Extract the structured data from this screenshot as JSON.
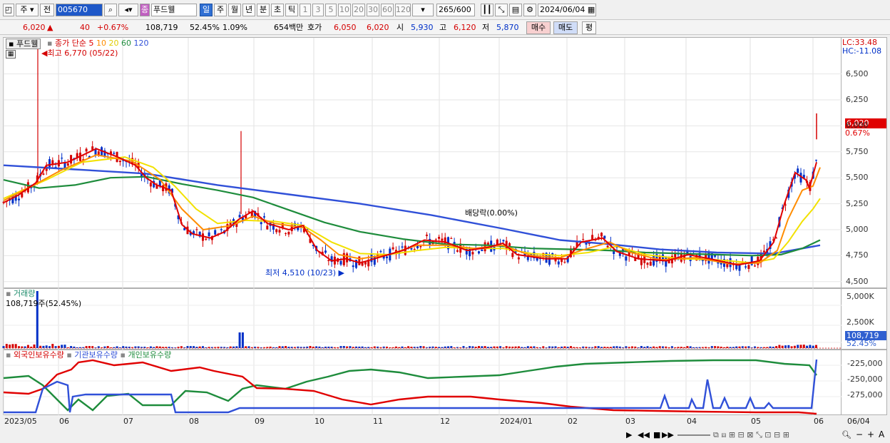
{
  "toolbar": {
    "period_type": "주",
    "all_label": "전",
    "code": "005670",
    "name_badge": "종",
    "stock_name": "푸드웰",
    "periods": [
      "일",
      "주",
      "월",
      "년",
      "분",
      "초",
      "틱"
    ],
    "minute_values": [
      "1",
      "3",
      "5",
      "10",
      "20",
      "30",
      "60",
      "120"
    ],
    "count": "265",
    "count_total": "/600",
    "date": "2024/06/04"
  },
  "quote": {
    "price": "6,020",
    "change_arrow": "▲",
    "change": "40",
    "change_pct": "+0.67%",
    "volume": "108,719",
    "volume_ratio": "52.45%",
    "turnover": "1.09%",
    "amount": "654백만",
    "ask_label": "호가",
    "ask": "6,050",
    "bid": "6,020",
    "open_label": "시",
    "open": "5,930",
    "high_label": "고",
    "high": "6,120",
    "low_label": "저",
    "low": "5,870",
    "buy_button": "매수",
    "sell_button": "매도",
    "flat_button": "평"
  },
  "price_panel": {
    "stock_tag": "푸드웰",
    "legend_prefix": "종가 단순",
    "ma_periods": [
      "5",
      "10",
      "20",
      "60",
      "120"
    ],
    "high_note": "최고 6,770 (05/22)",
    "low_note": "최저 4,510 (10/23)",
    "dividend_note": "배당락(0.00%)",
    "lc": "LC:33.48",
    "hc": "HC:-11.08",
    "current_price_tag": "6,020",
    "current_pct_tag": "0.67%"
  },
  "volume_panel": {
    "title": "거래량",
    "value_note": "108,719주(52.45%)",
    "current_tag": "108,719",
    "pct_tag": "52.45%"
  },
  "holdings_panel": {
    "foreign": "외국인보유수량",
    "institution": "기관보유수량",
    "individual": "개인보유수량"
  },
  "axes": {
    "price_ticks": [
      "6,500",
      "6,250",
      "6,000",
      "5,750",
      "5,500",
      "5,250",
      "5,000",
      "4,750",
      "4,500"
    ],
    "volume_ticks": [
      "5,000K",
      "2,500K"
    ],
    "holdings_ticks": [
      "-225,000",
      "-250,000",
      "-275,000"
    ],
    "x_labels": [
      "2023/05",
      "06",
      "07",
      "08",
      "09",
      "10",
      "11",
      "12",
      "2024/01",
      "02",
      "03",
      "04",
      "05",
      "06"
    ],
    "x_end_label": "06/04"
  },
  "colors": {
    "up": "#d40000",
    "down": "#0030c8",
    "ma5": "#e00000",
    "ma10": "#ff8c00",
    "ma20": "#f2e100",
    "ma60": "#1e8c3c",
    "ma120": "#3050d8"
  },
  "chart_data": {
    "type": "line",
    "series": [
      {
        "name": "5",
        "points": [
          [
            0,
            5260
          ],
          [
            20,
            5330
          ],
          [
            45,
            5450
          ],
          [
            60,
            5620
          ],
          [
            90,
            5650
          ],
          [
            130,
            5780
          ],
          [
            160,
            5700
          ],
          [
            185,
            5620
          ],
          [
            200,
            5500
          ],
          [
            215,
            5430
          ],
          [
            235,
            5380
          ],
          [
            250,
            5050
          ],
          [
            265,
            4960
          ],
          [
            290,
            4920
          ],
          [
            310,
            4980
          ],
          [
            330,
            5100
          ],
          [
            350,
            5180
          ],
          [
            370,
            5060
          ],
          [
            400,
            5000
          ],
          [
            420,
            5040
          ],
          [
            440,
            4800
          ],
          [
            460,
            4700
          ],
          [
            480,
            4720
          ],
          [
            500,
            4680
          ],
          [
            530,
            4740
          ],
          [
            560,
            4800
          ],
          [
            590,
            4900
          ],
          [
            620,
            4880
          ],
          [
            650,
            4800
          ],
          [
            680,
            4830
          ],
          [
            700,
            4870
          ],
          [
            720,
            4760
          ],
          [
            760,
            4720
          ],
          [
            790,
            4720
          ],
          [
            810,
            4880
          ],
          [
            840,
            4920
          ],
          [
            860,
            4790
          ],
          [
            890,
            4720
          ],
          [
            930,
            4700
          ],
          [
            960,
            4760
          ],
          [
            990,
            4720
          ],
          [
            1030,
            4660
          ],
          [
            1060,
            4700
          ],
          [
            1080,
            4880
          ],
          [
            1095,
            5250
          ],
          [
            1110,
            5550
          ],
          [
            1125,
            5480
          ],
          [
            1130,
            5400
          ],
          [
            1140,
            5650
          ]
        ]
      },
      {
        "name": "10",
        "points": [
          [
            0,
            5280
          ],
          [
            40,
            5420
          ],
          [
            80,
            5570
          ],
          [
            130,
            5720
          ],
          [
            180,
            5660
          ],
          [
            220,
            5480
          ],
          [
            250,
            5200
          ],
          [
            280,
            5000
          ],
          [
            320,
            5040
          ],
          [
            350,
            5130
          ],
          [
            380,
            5060
          ],
          [
            420,
            5020
          ],
          [
            445,
            4900
          ],
          [
            470,
            4760
          ],
          [
            500,
            4720
          ],
          [
            540,
            4760
          ],
          [
            580,
            4850
          ],
          [
            620,
            4850
          ],
          [
            660,
            4820
          ],
          [
            700,
            4850
          ],
          [
            740,
            4750
          ],
          [
            780,
            4730
          ],
          [
            810,
            4800
          ],
          [
            850,
            4880
          ],
          [
            880,
            4780
          ],
          [
            920,
            4710
          ],
          [
            970,
            4730
          ],
          [
            1020,
            4670
          ],
          [
            1060,
            4680
          ],
          [
            1085,
            4800
          ],
          [
            1100,
            5100
          ],
          [
            1120,
            5380
          ],
          [
            1135,
            5420
          ],
          [
            1145,
            5600
          ]
        ]
      },
      {
        "name": "20",
        "points": [
          [
            0,
            5300
          ],
          [
            60,
            5480
          ],
          [
            110,
            5650
          ],
          [
            170,
            5700
          ],
          [
            210,
            5600
          ],
          [
            240,
            5420
          ],
          [
            270,
            5200
          ],
          [
            300,
            5060
          ],
          [
            340,
            5090
          ],
          [
            380,
            5080
          ],
          [
            420,
            5040
          ],
          [
            460,
            4880
          ],
          [
            500,
            4770
          ],
          [
            540,
            4760
          ],
          [
            580,
            4800
          ],
          [
            620,
            4830
          ],
          [
            660,
            4820
          ],
          [
            700,
            4820
          ],
          [
            740,
            4770
          ],
          [
            780,
            4750
          ],
          [
            820,
            4780
          ],
          [
            860,
            4840
          ],
          [
            900,
            4760
          ],
          [
            950,
            4720
          ],
          [
            1000,
            4710
          ],
          [
            1050,
            4680
          ],
          [
            1080,
            4720
          ],
          [
            1100,
            4880
          ],
          [
            1120,
            5080
          ],
          [
            1135,
            5200
          ],
          [
            1145,
            5300
          ]
        ]
      },
      {
        "name": "60",
        "points": [
          [
            0,
            5480
          ],
          [
            50,
            5400
          ],
          [
            100,
            5430
          ],
          [
            150,
            5500
          ],
          [
            200,
            5510
          ],
          [
            250,
            5440
          ],
          [
            300,
            5380
          ],
          [
            350,
            5310
          ],
          [
            400,
            5190
          ],
          [
            450,
            5070
          ],
          [
            500,
            4980
          ],
          [
            560,
            4910
          ],
          [
            620,
            4860
          ],
          [
            680,
            4850
          ],
          [
            740,
            4820
          ],
          [
            800,
            4810
          ],
          [
            850,
            4800
          ],
          [
            900,
            4780
          ],
          [
            950,
            4770
          ],
          [
            1000,
            4760
          ],
          [
            1050,
            4750
          ],
          [
            1090,
            4760
          ],
          [
            1120,
            4820
          ],
          [
            1145,
            4900
          ]
        ]
      },
      {
        "name": "120",
        "points": [
          [
            0,
            5620
          ],
          [
            100,
            5580
          ],
          [
            200,
            5540
          ],
          [
            300,
            5430
          ],
          [
            400,
            5340
          ],
          [
            500,
            5250
          ],
          [
            600,
            5140
          ],
          [
            700,
            5010
          ],
          [
            780,
            4900
          ],
          [
            850,
            4860
          ],
          [
            920,
            4810
          ],
          [
            1000,
            4780
          ],
          [
            1080,
            4770
          ],
          [
            1145,
            4850
          ]
        ]
      }
    ],
    "x_unit": "chart-x",
    "ylim": [
      4450,
      6800
    ]
  }
}
